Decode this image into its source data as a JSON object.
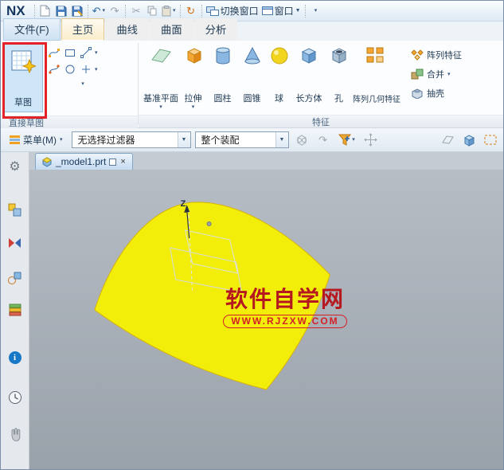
{
  "colors": {
    "annotation_red": "#e32228",
    "surface_yellow": "#f2ee0a",
    "watermark_red": "#b5181e",
    "viewport_gray": "#a9b0b8"
  },
  "icons": {
    "dropdown": "▼",
    "small_dropdown": "▾",
    "close": "×",
    "undo": "↶",
    "redo": "↷",
    "cut": "✂",
    "repeat": "↻",
    "gear": "⚙",
    "info": "i"
  },
  "titlebar": {
    "logo": "NX",
    "switch_window_label": "切换窗口",
    "window_label": "窗口"
  },
  "ribbon_tabs": [
    {
      "label": "文件(F)"
    },
    {
      "label": "主页"
    },
    {
      "label": "曲线"
    },
    {
      "label": "曲面"
    },
    {
      "label": "分析"
    }
  ],
  "ribbon": {
    "sketch_label": "草图",
    "direct_sketch_group_label": "直接草图",
    "feature_group_label": "特征",
    "features": [
      {
        "label": "基准平面"
      },
      {
        "label": "拉伸"
      },
      {
        "label": "圆柱"
      },
      {
        "label": "圆锥"
      },
      {
        "label": "球"
      },
      {
        "label": "长方体"
      },
      {
        "label": "孔"
      },
      {
        "label": "阵列几何特征"
      }
    ],
    "small_features": [
      {
        "label": "阵列特征"
      },
      {
        "label": "合并"
      },
      {
        "label": "抽壳"
      }
    ]
  },
  "toolbar": {
    "menu_label": "菜单(M)",
    "selection_filter_value": "无选择过滤器",
    "scope_value": "整个装配"
  },
  "part_tab": {
    "label": "_model1.prt"
  },
  "viewport": {
    "axis_label": "Z",
    "watermark_title": "软件自学网",
    "watermark_url": "WWW.RJZXW.COM"
  }
}
